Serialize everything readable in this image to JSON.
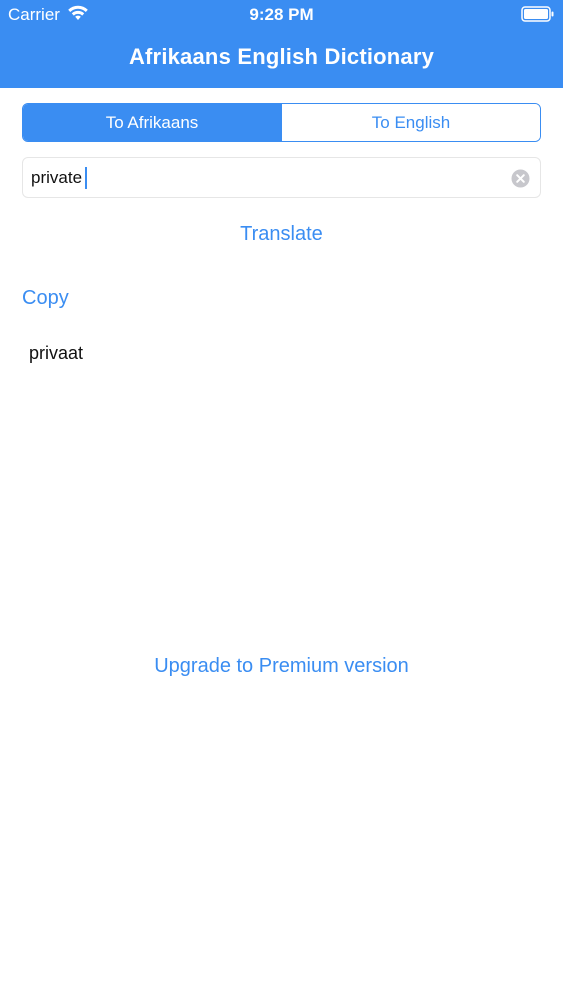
{
  "status_bar": {
    "carrier": "Carrier",
    "time": "9:28 PM"
  },
  "nav": {
    "title": "Afrikaans English Dictionary"
  },
  "segments": {
    "items": [
      {
        "label": "To Afrikaans",
        "selected": true
      },
      {
        "label": "To English",
        "selected": false
      }
    ]
  },
  "search": {
    "value": "private"
  },
  "actions": {
    "translate_label": "Translate",
    "copy_label": "Copy",
    "upgrade_label": "Upgrade to Premium version"
  },
  "result": {
    "text": "privaat"
  },
  "colors": {
    "accent": "#3a8df2",
    "text": "#111111",
    "background": "#ffffff"
  },
  "icons": {
    "wifi": "wifi-icon",
    "battery": "battery-icon",
    "clear": "clear-icon"
  }
}
